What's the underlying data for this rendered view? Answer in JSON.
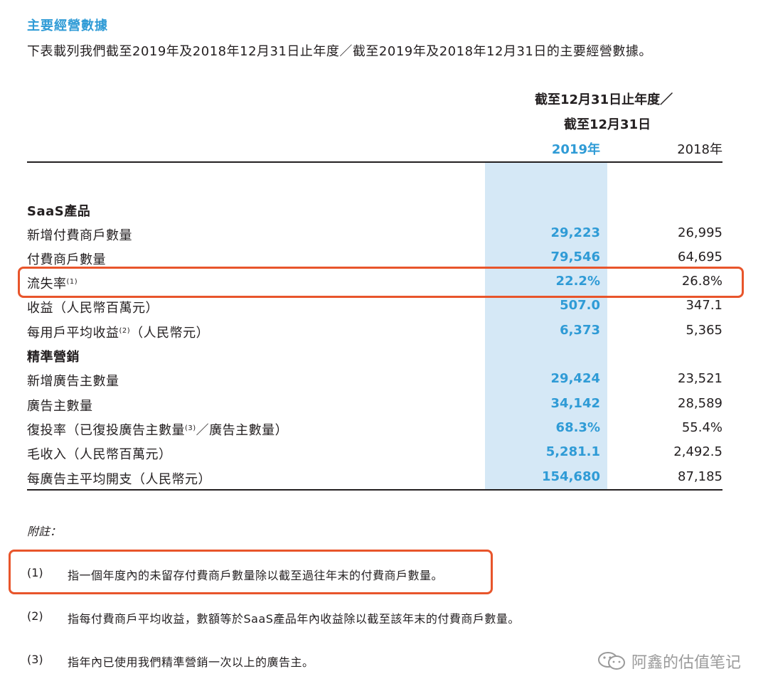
{
  "section_title": "主要經營數據",
  "intro": "下表載列我們截至2019年及2018年12月31日止年度／截至2019年及2018年12月31日的主要經營數據。",
  "header": {
    "line1": "截至12月31日止年度／",
    "line2": "截至12月31日",
    "col_2019": "2019年",
    "col_2018": "2018年"
  },
  "rows": [
    {
      "label": "SaaS產品",
      "section": true,
      "v2019": "",
      "v2018": ""
    },
    {
      "label": "新增付費商戶數量",
      "v2019": "29,223",
      "v2018": "26,995"
    },
    {
      "label": "付費商戶數量",
      "v2019": "79,546",
      "v2018": "64,695"
    },
    {
      "label": "流失率",
      "sup": "(1)",
      "v2019": "22.2%",
      "v2018": "26.8%"
    },
    {
      "label": "收益（人民幣百萬元）",
      "v2019": "507.0",
      "v2018": "347.1"
    },
    {
      "label": "每用戶平均收益",
      "sup": "(2)",
      "label_suffix": "（人民幣元）",
      "v2019": "6,373",
      "v2018": "5,365"
    },
    {
      "label": "精準營銷",
      "section": true,
      "v2019": "",
      "v2018": ""
    },
    {
      "label": "新增廣告主數量",
      "v2019": "29,424",
      "v2018": "23,521"
    },
    {
      "label": "廣告主數量",
      "v2019": "34,142",
      "v2018": "28,589"
    },
    {
      "label": "復投率（已復投廣告主數量",
      "sup": "(3)",
      "label_suffix": "／廣告主數量）",
      "v2019": "68.3%",
      "v2018": "55.4%"
    },
    {
      "label": "毛收入（人民幣百萬元）",
      "v2019": "5,281.1",
      "v2018": "2,492.5"
    },
    {
      "label": "每廣告主平均開支（人民幣元）",
      "v2019": "154,680",
      "v2018": "87,185"
    }
  ],
  "notes_title": "附註：",
  "notes": [
    {
      "num": "(1)",
      "text": "指一個年度內的未留存付費商戶數量除以截至過往年末的付費商戶數量。"
    },
    {
      "num": "(2)",
      "text": "指每付費商戶平均收益，數額等於SaaS產品年內收益除以截至該年末的付費商戶數量。"
    },
    {
      "num": "(3)",
      "text": "指年內已使用我們精準營銷一次以上的廣告主。"
    }
  ],
  "watermark": "阿鑫的估值笔记",
  "colors": {
    "accent": "#2f9bd6",
    "highlight": "#e8552b",
    "shade": "#d5e8f6"
  }
}
